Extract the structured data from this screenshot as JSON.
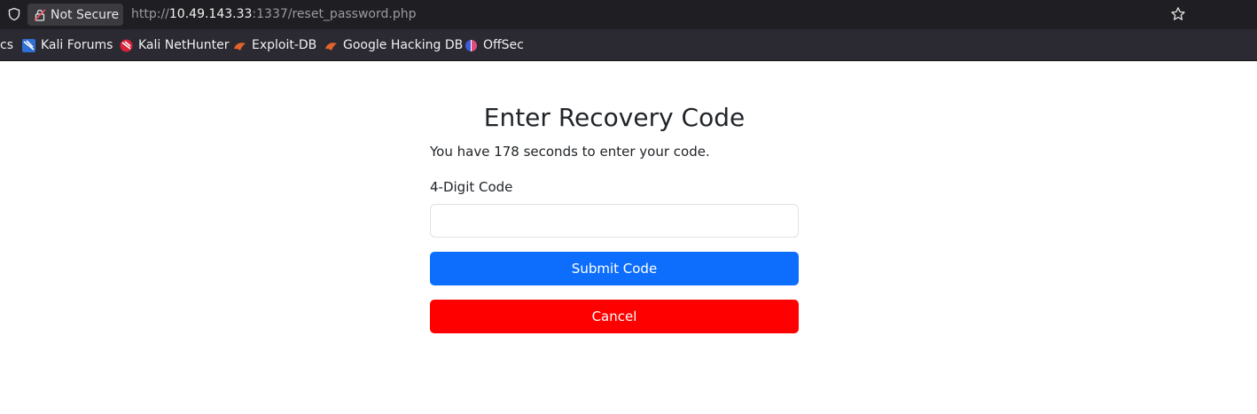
{
  "browser": {
    "security_label": "Not Secure",
    "url_scheme": "http://",
    "url_host": "10.49.143.33",
    "url_rest": ":1337/reset_password.php"
  },
  "bookmarks": [
    {
      "label": "cs",
      "icon": "none"
    },
    {
      "label": "Kali Forums",
      "icon": "kali-forums-icon"
    },
    {
      "label": "Kali NetHunter",
      "icon": "kali-nethunter-icon"
    },
    {
      "label": "Exploit-DB",
      "icon": "exploit-db-icon"
    },
    {
      "label": "Google Hacking DB",
      "icon": "google-hacking-db-icon"
    },
    {
      "label": "OffSec",
      "icon": "offsec-icon"
    }
  ],
  "form": {
    "title": "Enter Recovery Code",
    "timer_text": "You have 178 seconds to enter your code.",
    "code_label": "4-Digit Code",
    "code_value": "",
    "submit_label": "Submit Code",
    "cancel_label": "Cancel"
  },
  "colors": {
    "submit": "#0d6efd",
    "cancel": "#ff0000",
    "browser_chrome": "#1f1f23",
    "bookmarks_bar": "#2b2a33"
  }
}
